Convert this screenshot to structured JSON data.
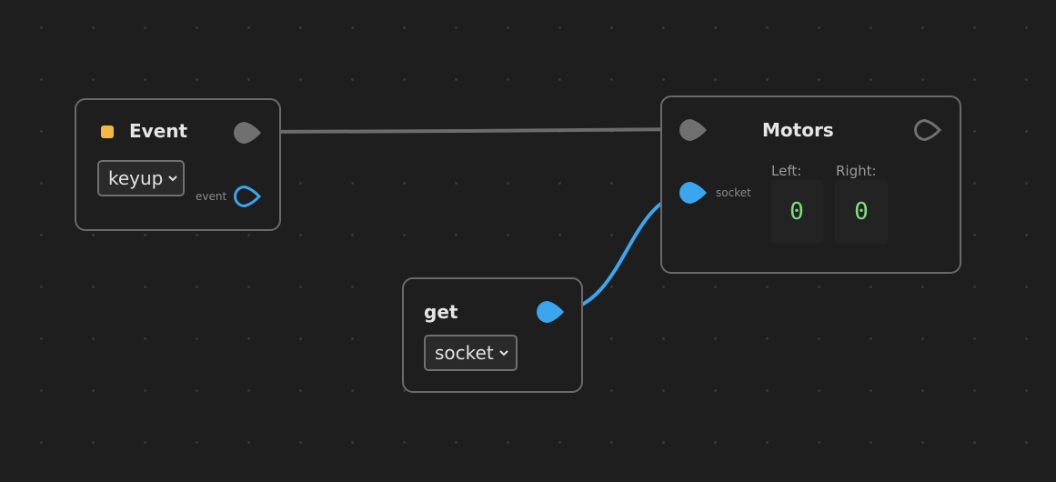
{
  "colors": {
    "background": "#1e1e1e",
    "node_border": "#6a6a6a",
    "exec_port": "#707070",
    "data_port": "#3aa6f0",
    "event_dot": "#f5b942",
    "value_text": "#7de07d"
  },
  "event_node": {
    "title": "Event",
    "select_value": "keyup",
    "output_label": "event"
  },
  "get_node": {
    "title": "get",
    "select_value": "socket"
  },
  "motors_node": {
    "title": "Motors",
    "input_label": "socket",
    "left_label": "Left:",
    "right_label": "Right:",
    "left_value": "0",
    "right_value": "0"
  }
}
